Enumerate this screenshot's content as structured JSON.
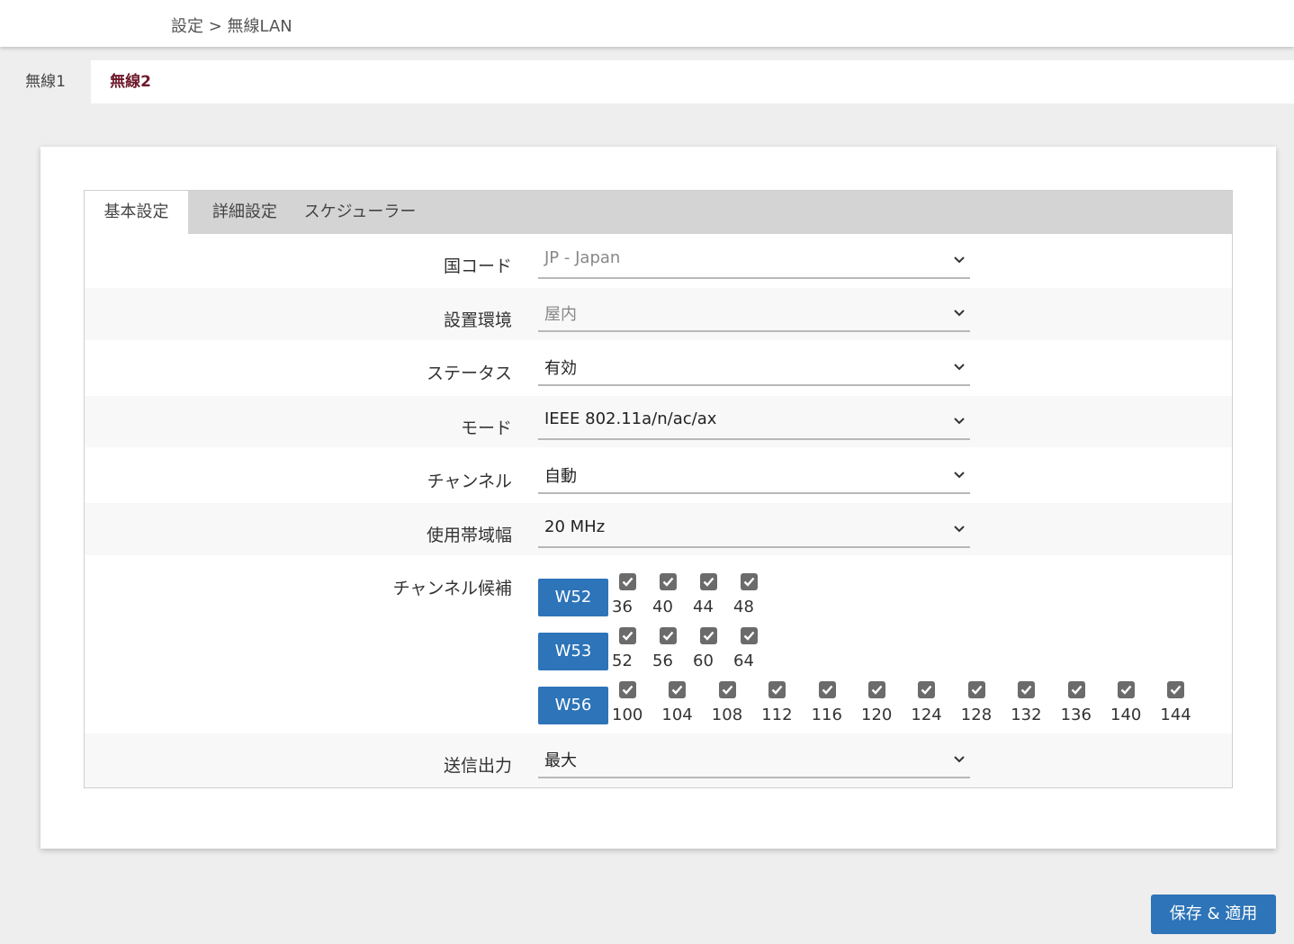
{
  "breadcrumb": "設定 > 無線LAN",
  "top_tabs": [
    {
      "label": "無線1",
      "active": false
    },
    {
      "label": "無線2",
      "active": true
    }
  ],
  "sub_tabs": [
    {
      "label": "基本設定",
      "active": true
    },
    {
      "label": "詳細設定",
      "active": false
    },
    {
      "label": "スケジューラー",
      "active": false
    }
  ],
  "fields": {
    "country": {
      "label": "国コード",
      "value": "JP - Japan",
      "disabled": true
    },
    "environment": {
      "label": "設置環境",
      "value": "屋内",
      "disabled": true
    },
    "status": {
      "label": "ステータス",
      "value": "有効"
    },
    "mode": {
      "label": "モード",
      "value": "IEEE 802.11a/n/ac/ax"
    },
    "channel": {
      "label": "チャンネル",
      "value": "自動"
    },
    "bandwidth": {
      "label": "使用帯域幅",
      "value": "20 MHz"
    },
    "tx_power": {
      "label": "送信出力",
      "value": "最大"
    }
  },
  "channel_candidates": {
    "label": "チャンネル候補",
    "groups": [
      {
        "name": "W52",
        "channels": [
          "36",
          "40",
          "44",
          "48"
        ]
      },
      {
        "name": "W53",
        "channels": [
          "52",
          "56",
          "60",
          "64"
        ]
      },
      {
        "name": "W56",
        "channels": [
          "100",
          "104",
          "108",
          "112",
          "116",
          "120",
          "124",
          "128",
          "132",
          "136",
          "140",
          "144"
        ]
      }
    ]
  },
  "save_button": "保存 & 適用",
  "colors": {
    "accent": "#2d74b8",
    "active_tab_text": "#6e1a2a",
    "checkbox": "#6b6b6b"
  },
  "icons": {
    "select": "chevron-down-icon",
    "checkbox": "checkmark-icon"
  }
}
